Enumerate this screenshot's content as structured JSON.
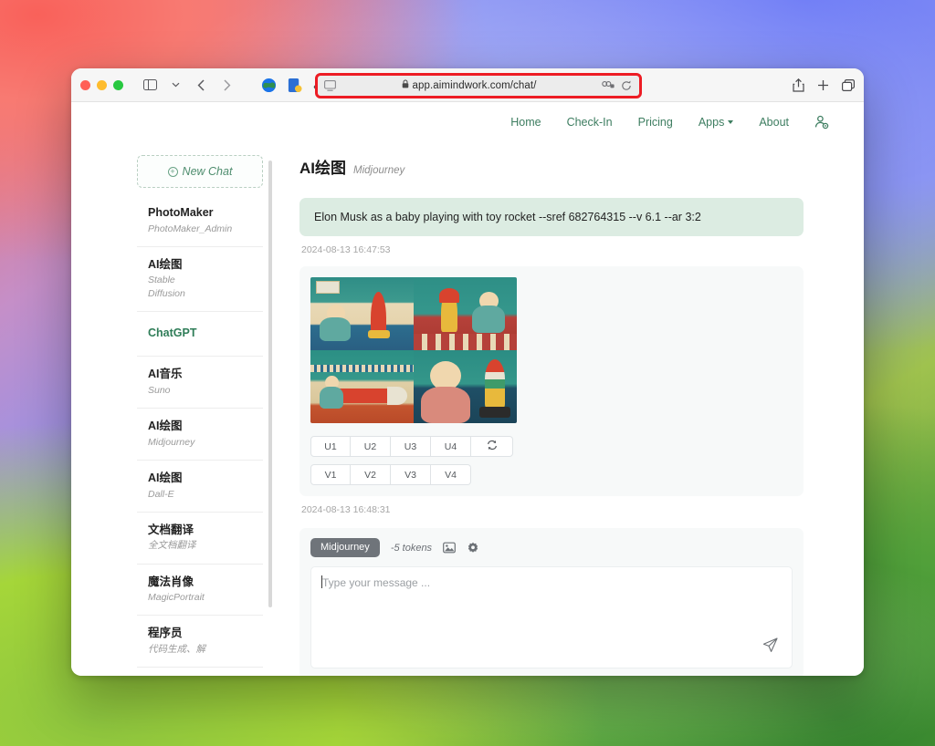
{
  "browser": {
    "url": "app.aimindwork.com/chat/",
    "lock_icon": "lock-icon",
    "traffic_lights": [
      "close",
      "minimize",
      "zoom"
    ],
    "toolbar_icons": [
      "sidebar-toggle-icon",
      "chevron-down-icon",
      "back-arrow-icon",
      "forward-arrow-icon",
      "extension-globe-icon",
      "extension-note-icon",
      "extension-cloud-icon",
      "extension-m-icon",
      "extension-info-icon"
    ],
    "right_icons": [
      "share-icon",
      "new-tab-icon",
      "tab-overview-icon"
    ],
    "address_icons": [
      "reader-view-icon",
      "extension-toggle-icon",
      "reload-icon"
    ],
    "highlight": "#ed1c24"
  },
  "topnav": {
    "items": [
      {
        "label": "Home",
        "name": "nav-home"
      },
      {
        "label": "Check-In",
        "name": "nav-checkin"
      },
      {
        "label": "Pricing",
        "name": "nav-pricing"
      },
      {
        "label": "Apps",
        "name": "nav-apps",
        "has_caret": true
      },
      {
        "label": "About",
        "name": "nav-about"
      }
    ],
    "account_icon": "user-gear-icon",
    "accent": "#3d7d60"
  },
  "sidebar": {
    "new_chat": "New Chat",
    "new_chat_icon": "plus-circle-icon",
    "items": [
      {
        "name": "PhotoMaker",
        "sub": "PhotoMaker_Admin",
        "active": false
      },
      {
        "name": "AI绘图",
        "sub": "Stable Diffusion",
        "active": false
      },
      {
        "name": "ChatGPT",
        "sub": "",
        "active": true
      },
      {
        "name": "AI音乐",
        "sub": "Suno",
        "active": false
      },
      {
        "name": "AI绘图",
        "sub": "Midjourney",
        "active": false
      },
      {
        "name": "AI绘图",
        "sub": "Dall-E",
        "active": false
      },
      {
        "name": "文档翻译",
        "sub": "全文档翻译",
        "active": false
      },
      {
        "name": "魔法肖像",
        "sub": "MagicPortrait",
        "active": false
      },
      {
        "name": "程序员",
        "sub": "代码生成、解",
        "active": false
      }
    ]
  },
  "chat": {
    "title": "AI绘图",
    "subtitle": "Midjourney",
    "prompt": "Elon Musk as a baby playing with toy rocket --sref 682764315 --v 6.1 --ar 3:2",
    "prompt_timestamp": "2024-08-13 16:47:53",
    "response_timestamp": "2024-08-13 16:48:31",
    "image_alt": "2x2 grid of retro illustrations of a baby playing with toy rockets",
    "upscale_buttons": [
      "U1",
      "U2",
      "U3",
      "U4"
    ],
    "reroll_icon": "refresh-icon",
    "variation_buttons": [
      "V1",
      "V2",
      "V3",
      "V4"
    ]
  },
  "composer": {
    "model_chip": "Midjourney",
    "tokens": "-5 tokens",
    "image_icon": "image-icon",
    "settings_icon": "gear-icon",
    "placeholder": "Type your message ...",
    "send_icon": "send-icon"
  }
}
